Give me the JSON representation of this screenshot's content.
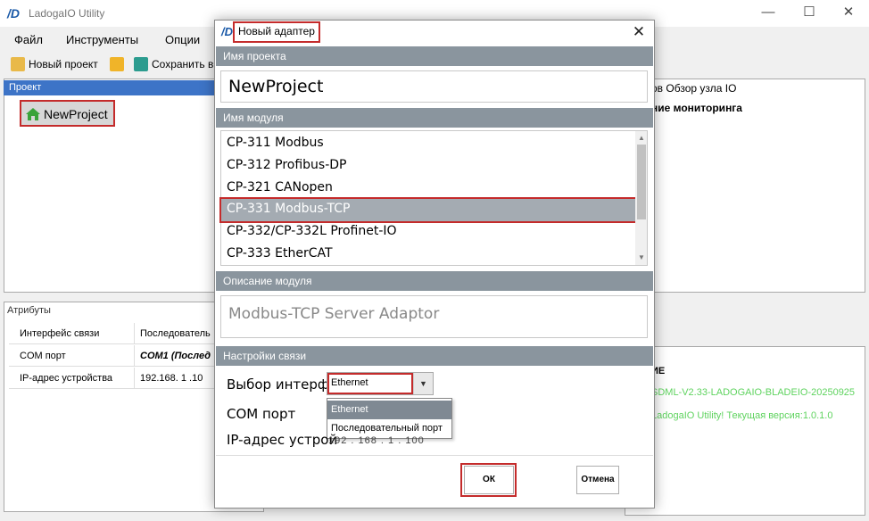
{
  "app": {
    "title": "LadogaIO Utility"
  },
  "menu": [
    "Файл",
    "Инструменты",
    "Опции"
  ],
  "toolbar": {
    "new_project": "Новый проект",
    "save": "Сохранить в"
  },
  "project_panel": {
    "header": "Проект",
    "tree_item": "NewProject"
  },
  "attributes": {
    "title": "Атрибуты",
    "rows": [
      {
        "key": "Интерфейс связи",
        "value": "Последователь"
      },
      {
        "key": "COM порт",
        "value": "COM1 (Послед"
      },
      {
        "key": "IP-адрес устройства",
        "value": "192.168.  1  .10"
      }
    ]
  },
  "right_panel": {
    "tabs": "ов  Обзор узла IO",
    "header": "ние мониторинга"
  },
  "log_panel": {
    "header": "ИЕ",
    "lines": [
      "SDML-V2.33-LADOGAIO-BLADEIO-20250925",
      "LadogaIO Utility! Текущая версия:1.0.1.0"
    ]
  },
  "dialog": {
    "title": "Новый адаптер",
    "project_name_label": "Имя проекта",
    "project_name_value": "NewProject",
    "module_name_label": "Имя модуля",
    "modules": [
      "CP-311 Modbus",
      "CP-312 Profibus-DP",
      "CP-321 CANopen",
      "CP-331 Modbus-TCP",
      "CP-332/CP-332L Profinet-IO",
      "CP-333 EtherCAT"
    ],
    "selected_module_index": 3,
    "description_label": "Описание модуля",
    "description": "Modbus-TCP Server Adaptor",
    "settings_label": "Настройки связи",
    "interface_label": "Выбор интерфе",
    "interface_value": "Ethernet",
    "interface_options": [
      "Ethernet",
      "Последовательный порт"
    ],
    "com_label": "COM порт",
    "ip_label": "IP-адрес устрой",
    "ip_value": "192 . 168 .  1  . 100",
    "ok": "ОК",
    "cancel": "Отмена"
  },
  "colors": {
    "section_header": "#8a959e",
    "selected_item": "#a4abb2",
    "highlight": "#c42b2b",
    "log_text": "#5fd35f",
    "project_header": "#3d74c7"
  },
  "icons": [
    "app-logo-icon",
    "new-project-icon",
    "open-folder-icon",
    "save-icon",
    "house-icon",
    "close-icon",
    "chevron-down-icon"
  ]
}
